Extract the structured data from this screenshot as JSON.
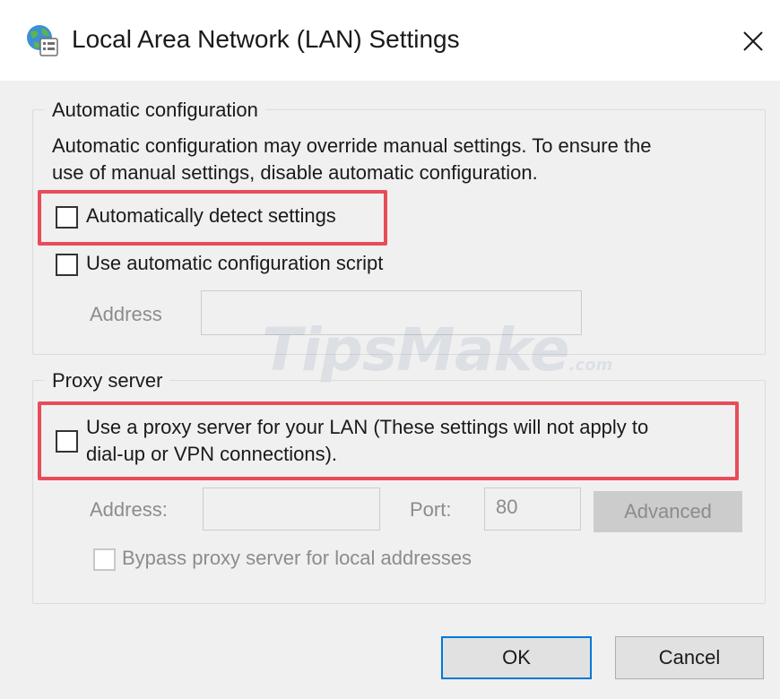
{
  "window": {
    "title": "Local Area Network (LAN) Settings",
    "icon": "globe-settings-icon",
    "close_icon": "close-icon"
  },
  "auto_config": {
    "legend": "Automatic configuration",
    "description_line1": "Automatic configuration may override manual settings.  To ensure the",
    "description_line2": "use of manual settings, disable automatic configuration.",
    "auto_detect_label": "Automatically detect settings",
    "auto_detect_checked": false,
    "use_script_label": "Use automatic configuration script",
    "use_script_checked": false,
    "address_label": "Address",
    "address_value": ""
  },
  "proxy": {
    "legend": "Proxy server",
    "use_proxy_line1": "Use a proxy server for your LAN (These settings will not apply to",
    "use_proxy_line2": "dial-up or VPN connections).",
    "use_proxy_checked": false,
    "address_label": "Address:",
    "address_value": "",
    "port_label": "Port:",
    "port_value": "80",
    "advanced_label": "Advanced",
    "bypass_label": "Bypass proxy server for local addresses",
    "bypass_checked": false
  },
  "buttons": {
    "ok_label": "OK",
    "cancel_label": "Cancel"
  },
  "watermark": {
    "brand": "TipsMake",
    "suffix": ".com"
  },
  "colors": {
    "highlight": "#e84c5a",
    "focus_border": "#0078d7",
    "background": "#f0f0f0"
  }
}
